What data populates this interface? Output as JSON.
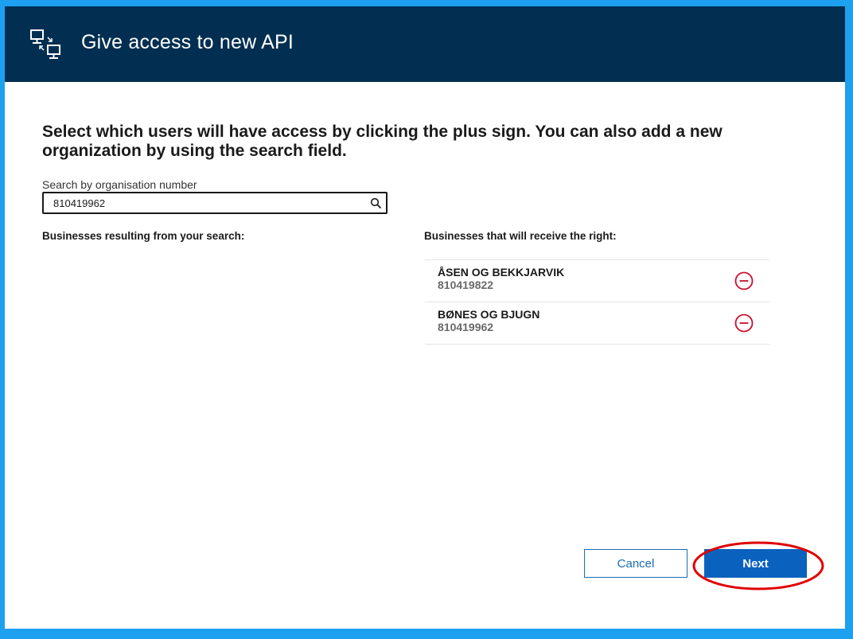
{
  "header": {
    "title": "Give access to new API",
    "icon": "api-access-icon"
  },
  "instructions": "Select which users will have access by clicking the plus sign. You can also add a new organization by using the search field.",
  "search": {
    "label": "Search by organisation number",
    "value": "810419962",
    "icon": "search-icon"
  },
  "results": {
    "heading": "Businesses resulting from your search:",
    "items": []
  },
  "recipients": {
    "heading": "Businesses that will receive the right:",
    "items": [
      {
        "name": "ÅSEN OG BEKKJARVIK",
        "number": "810419822",
        "action_icon": "remove-circle-icon"
      },
      {
        "name": "BØNES OG BJUGN",
        "number": "810419962",
        "action_icon": "remove-circle-icon"
      }
    ]
  },
  "actions": {
    "cancel_label": "Cancel",
    "next_label": "Next"
  },
  "colors": {
    "header_bg": "#022F51",
    "window_border": "#1EA0F0",
    "primary": "#0A62BE",
    "remove": "#C8102E",
    "annotation": "#E00000"
  }
}
